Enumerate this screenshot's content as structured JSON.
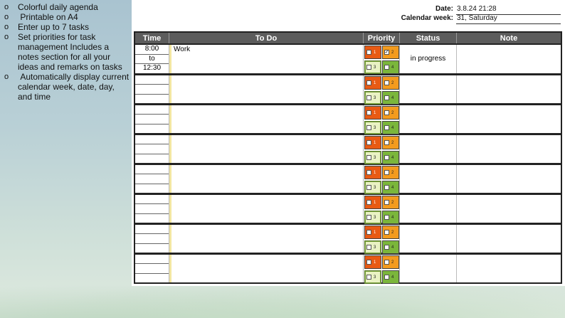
{
  "features": [
    {
      "bullet": "o",
      "text": "Colorful daily agenda"
    },
    {
      "bullet": "o",
      "text": " Printable on A4"
    },
    {
      "bullet": "o",
      "text": "Enter up to 7 tasks"
    },
    {
      "bullet": "o",
      "text": "Set priorities for task management Includes a notes section for all your ideas and remarks on tasks"
    },
    {
      "bullet": "o",
      "text": " Automatically display current calendar week, date, day, and time"
    }
  ],
  "header": {
    "date_label": "Date:",
    "date_value": "3.8.24 21:28",
    "week_label": "Calendar week:",
    "week_value": "31, Saturday"
  },
  "columns": {
    "time": "Time",
    "todo": "To Do",
    "priority": "Priority",
    "status": "Status",
    "note": "Note"
  },
  "priority_numbers": [
    "1",
    "2",
    "3",
    "4"
  ],
  "priority_colors": {
    "p1": "#e85a14",
    "p2": "#f39b1e",
    "p3": "#e9f2c3",
    "p4": "#7bb63b"
  },
  "rows": [
    {
      "time_from": "8:00",
      "time_sep": "to",
      "time_to": "12:30",
      "todo": "Work",
      "status": "in progress",
      "note": "",
      "checked": [
        false,
        true,
        false,
        false
      ]
    },
    {
      "time_from": "",
      "time_sep": "",
      "time_to": "",
      "todo": "",
      "status": "",
      "note": "",
      "checked": [
        false,
        false,
        false,
        false
      ]
    },
    {
      "time_from": "",
      "time_sep": "",
      "time_to": "",
      "todo": "",
      "status": "",
      "note": "",
      "checked": [
        false,
        false,
        false,
        false
      ]
    },
    {
      "time_from": "",
      "time_sep": "",
      "time_to": "",
      "todo": "",
      "status": "",
      "note": "",
      "checked": [
        false,
        false,
        false,
        false
      ]
    },
    {
      "time_from": "",
      "time_sep": "",
      "time_to": "",
      "todo": "",
      "status": "",
      "note": "",
      "checked": [
        false,
        false,
        false,
        false
      ]
    },
    {
      "time_from": "",
      "time_sep": "",
      "time_to": "",
      "todo": "",
      "status": "",
      "note": "",
      "checked": [
        false,
        false,
        false,
        false
      ]
    },
    {
      "time_from": "",
      "time_sep": "",
      "time_to": "",
      "todo": "",
      "status": "",
      "note": "",
      "checked": [
        false,
        false,
        false,
        false
      ]
    },
    {
      "time_from": "",
      "time_sep": "",
      "time_to": "",
      "todo": "",
      "status": "",
      "note": "",
      "checked": [
        false,
        false,
        false,
        false
      ]
    }
  ]
}
